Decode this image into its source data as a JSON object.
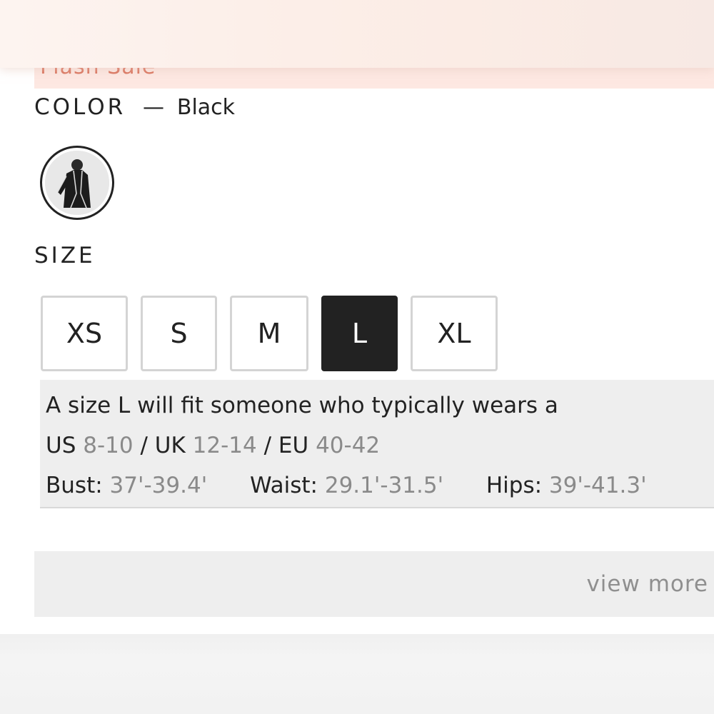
{
  "banner": {
    "text": "Flash Sale"
  },
  "color": {
    "label": "COLOR",
    "separator": "—",
    "value": "Black"
  },
  "size": {
    "label": "SIZE",
    "options": [
      "XS",
      "S",
      "M",
      "L",
      "XL"
    ],
    "selected": "L"
  },
  "fit": {
    "line1": "A size L will fit someone who typically wears a",
    "us_label": "US",
    "us_value": "8-10",
    "uk_label": "UK",
    "uk_value": "12-14",
    "eu_label": "EU",
    "eu_value": "40-42",
    "slash": "/",
    "bust_label": "Bust:",
    "bust_value": "37'-39.4'",
    "waist_label": "Waist:",
    "waist_value": "29.1'-31.5'",
    "hips_label": "Hips:",
    "hips_value": "39'-41.3'"
  },
  "view_more": {
    "label": "view more"
  },
  "colors": {
    "accent_dark": "#222222",
    "banner_bg": "#fde8e2",
    "banner_text": "#d9705a",
    "panel_bg": "#eeeeee",
    "muted_text": "#8a8a8a"
  }
}
